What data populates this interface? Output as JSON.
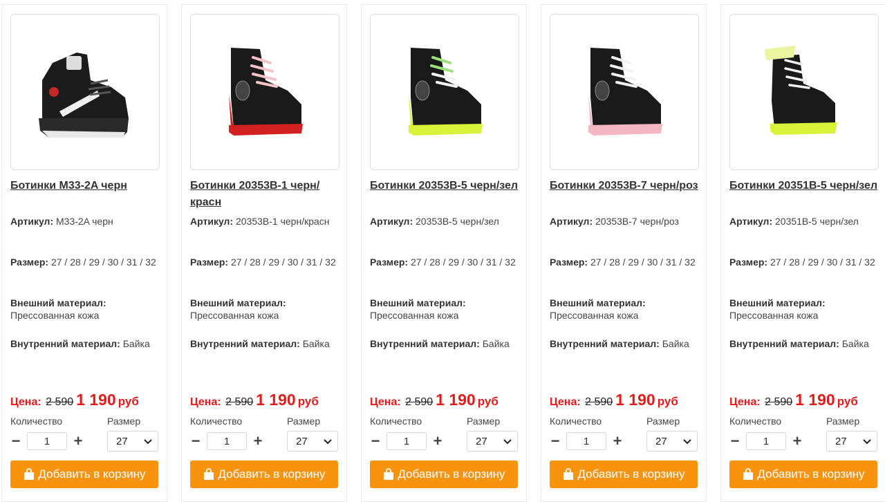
{
  "labels": {
    "article": "Артикул:",
    "size": "Размер:",
    "outer_material": "Внешний материал:",
    "inner_material": "Внутренний материал:",
    "price": "Цена:",
    "currency": "руб",
    "quantity": "Количество",
    "size_select": "Размер",
    "add_to_cart": "Добавить в корзину"
  },
  "colors": {
    "accent_orange": "#f7930d",
    "price_red": "#e31b1b"
  },
  "products": [
    {
      "title": "Ботинки M33-2A черн",
      "article": "M33-2A черн",
      "sizes": "27 / 28 / 29 / 30 / 31 / 32",
      "outer_material": "Прессованная кожа",
      "inner_material": "Байка",
      "old_price": "2 590",
      "new_price": "1 190",
      "quantity": "1",
      "selected_size": "27",
      "image_icon": "boot-sneaker-image"
    },
    {
      "title": "Ботинки 20353B-1 черн/красн",
      "article": "20353B-1 черн/красн",
      "sizes": "27 / 28 / 29 / 30 / 31 / 32",
      "outer_material": "Прессованная кожа",
      "inner_material": "Байка",
      "old_price": "2 590",
      "new_price": "1 190",
      "quantity": "1",
      "selected_size": "27",
      "image_icon": "boot-image"
    },
    {
      "title": "Ботинки 20353B-5 черн/зел",
      "article": "20353B-5 черн/зел",
      "sizes": "27 / 28 / 29 / 30 / 31 / 32",
      "outer_material": "Прессованная кожа",
      "inner_material": "Байка",
      "old_price": "2 590",
      "new_price": "1 190",
      "quantity": "1",
      "selected_size": "27",
      "image_icon": "boot-image"
    },
    {
      "title": "Ботинки 20353B-7 черн/роз",
      "article": "20353B-7 черн/роз",
      "sizes": "27 / 28 / 29 / 30 / 31 / 32",
      "outer_material": "Прессованная кожа",
      "inner_material": "Байка",
      "old_price": "2 590",
      "new_price": "1 190",
      "quantity": "1",
      "selected_size": "27",
      "image_icon": "boot-image"
    },
    {
      "title": "Ботинки 20351B-5 черн/зел",
      "article": "20351B-5 черн/зел",
      "sizes": "27 / 28 / 29 / 30 / 31 / 32",
      "outer_material": "Прессованная кожа",
      "inner_material": "Байка",
      "old_price": "2 590",
      "new_price": "1 190",
      "quantity": "1",
      "selected_size": "27",
      "image_icon": "boot-image"
    }
  ]
}
